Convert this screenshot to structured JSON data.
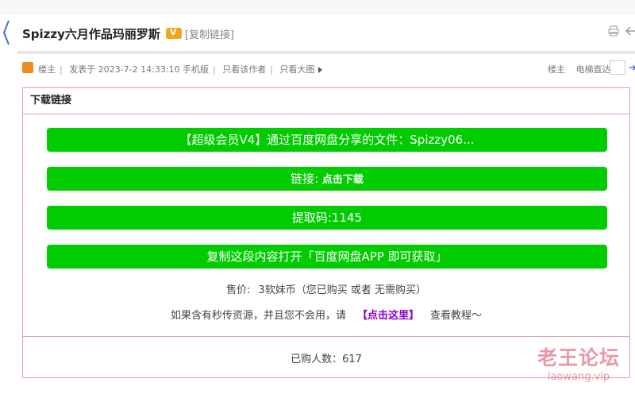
{
  "thread": {
    "title": "Spizzy六月作品玛丽罗斯",
    "copy_link_label": "[复制链接]"
  },
  "post_meta": {
    "author_label": "楼主",
    "posted": "发表于 2023-7-2 14:33:10 手机版",
    "only_author": "只看该作者",
    "only_images": "只看大图",
    "floor": "楼主",
    "jump_label": "电梯直达"
  },
  "download": {
    "header": "下载链接",
    "share_button": "【超级会员V4】通过百度网盘分享的文件：Spizzy06...",
    "link_prefix": "链接:",
    "link_label": "点击下载",
    "code_button": "提取码:1145",
    "copy_button": "复制这段内容打开「百度网盘APP 即可获取」",
    "price_label": "售价:",
    "price_value": "3软妹币（您已购买 或者 无需购买）",
    "tip_text": "如果含有秒传资源，并且您不会用，请",
    "tip_link": "【点击这里】",
    "tip_suffix": "查看教程～",
    "buyers": "已购人数：617"
  },
  "watermark": {
    "cn": "老王论坛",
    "en": "laowang.vip"
  },
  "colors": {
    "button_green": "#00cc00",
    "box_border": "#e0a0a8",
    "link_purple": "#8a00c8"
  }
}
